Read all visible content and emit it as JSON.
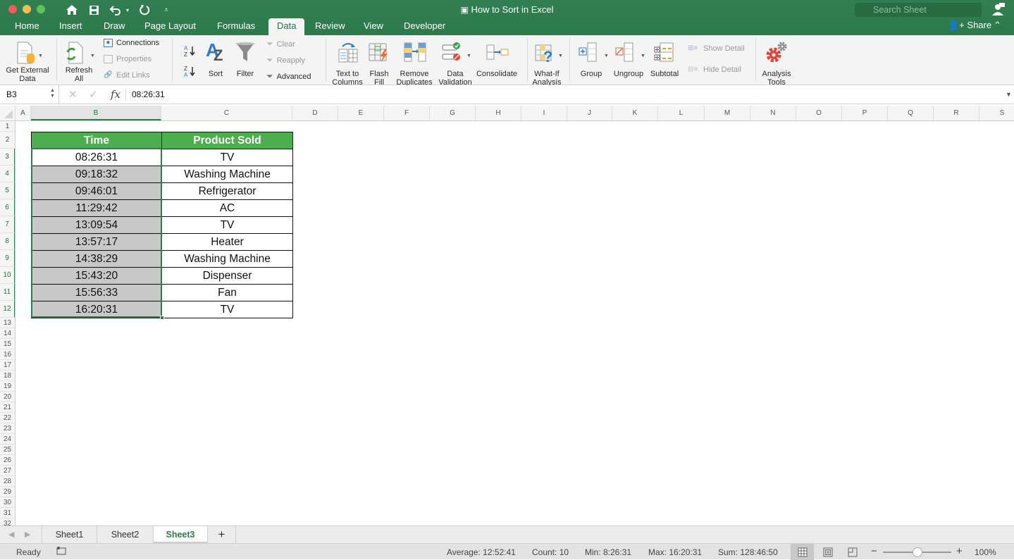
{
  "window": {
    "title": "How to Sort in Excel",
    "search_placeholder": "Search Sheet"
  },
  "menu_tabs": [
    {
      "label": "Home"
    },
    {
      "label": "Insert"
    },
    {
      "label": "Draw"
    },
    {
      "label": "Page Layout"
    },
    {
      "label": "Formulas"
    },
    {
      "label": "Data",
      "active": true
    },
    {
      "label": "Review"
    },
    {
      "label": "View"
    },
    {
      "label": "Developer"
    }
  ],
  "share_label": "Share",
  "ribbon": {
    "get_external_data": "Get External\nData",
    "get_external_data_l1": "Get External",
    "get_external_data_l2": "Data",
    "refresh_all_l1": "Refresh",
    "refresh_all_l2": "All",
    "connections": "Connections",
    "properties": "Properties",
    "edit_links": "Edit Links",
    "sort_az": "A→Z",
    "sort_za": "Z→A",
    "sort": "Sort",
    "filter": "Filter",
    "clear": "Clear",
    "reapply": "Reapply",
    "advanced": "Advanced",
    "text_to_columns_l1": "Text to",
    "text_to_columns_l2": "Columns",
    "flash_fill_l1": "Flash",
    "flash_fill_l2": "Fill",
    "remove_duplicates_l1": "Remove",
    "remove_duplicates_l2": "Duplicates",
    "data_validation_l1": "Data",
    "data_validation_l2": "Validation",
    "consolidate": "Consolidate",
    "what_if_l1": "What-If",
    "what_if_l2": "Analysis",
    "group": "Group",
    "ungroup": "Ungroup",
    "subtotal": "Subtotal",
    "show_detail": "Show Detail",
    "hide_detail": "Hide Detail",
    "analysis_tools_l1": "Analysis",
    "analysis_tools_l2": "Tools"
  },
  "formula_bar": {
    "name_box": "B3",
    "fx": "fx",
    "value": "08:26:31"
  },
  "columns": [
    "A",
    "B",
    "C",
    "D",
    "E",
    "F",
    "G",
    "H",
    "I",
    "J",
    "K",
    "L",
    "M",
    "N",
    "O",
    "P",
    "Q",
    "R",
    "S"
  ],
  "rows": [
    "1",
    "2",
    "3",
    "4",
    "5",
    "6",
    "7",
    "8",
    "9",
    "10",
    "11",
    "12",
    "13",
    "14",
    "15",
    "16",
    "17",
    "18",
    "19",
    "20",
    "21",
    "22",
    "23",
    "24",
    "25",
    "26",
    "27",
    "28",
    "29",
    "30",
    "31",
    "32"
  ],
  "table": {
    "headers": [
      "Time",
      "Product Sold"
    ],
    "rows": [
      [
        "08:26:31",
        "TV"
      ],
      [
        "09:18:32",
        "Washing Machine"
      ],
      [
        "09:46:01",
        "Refrigerator"
      ],
      [
        "11:29:42",
        "AC"
      ],
      [
        "13:09:54",
        "TV"
      ],
      [
        "13:57:17",
        "Heater"
      ],
      [
        "14:38:29",
        "Washing Machine"
      ],
      [
        "15:43:20",
        "Dispenser"
      ],
      [
        "15:56:33",
        "Fan"
      ],
      [
        "16:20:31",
        "TV"
      ]
    ]
  },
  "sheets": [
    {
      "label": "Sheet1"
    },
    {
      "label": "Sheet2"
    },
    {
      "label": "Sheet3",
      "active": true
    }
  ],
  "status": {
    "mode": "Ready",
    "average": "Average: 12:52:41",
    "count": "Count: 10",
    "min": "Min: 8:26:31",
    "max": "Max: 16:20:31",
    "sum": "Sum: 128:46:50",
    "zoom": "100%",
    "zoom_level_percent": 100
  },
  "colors": {
    "accent": "#2e7d4f",
    "header_fill": "#4cae4f",
    "selection_fill": "#c8c8c8"
  }
}
